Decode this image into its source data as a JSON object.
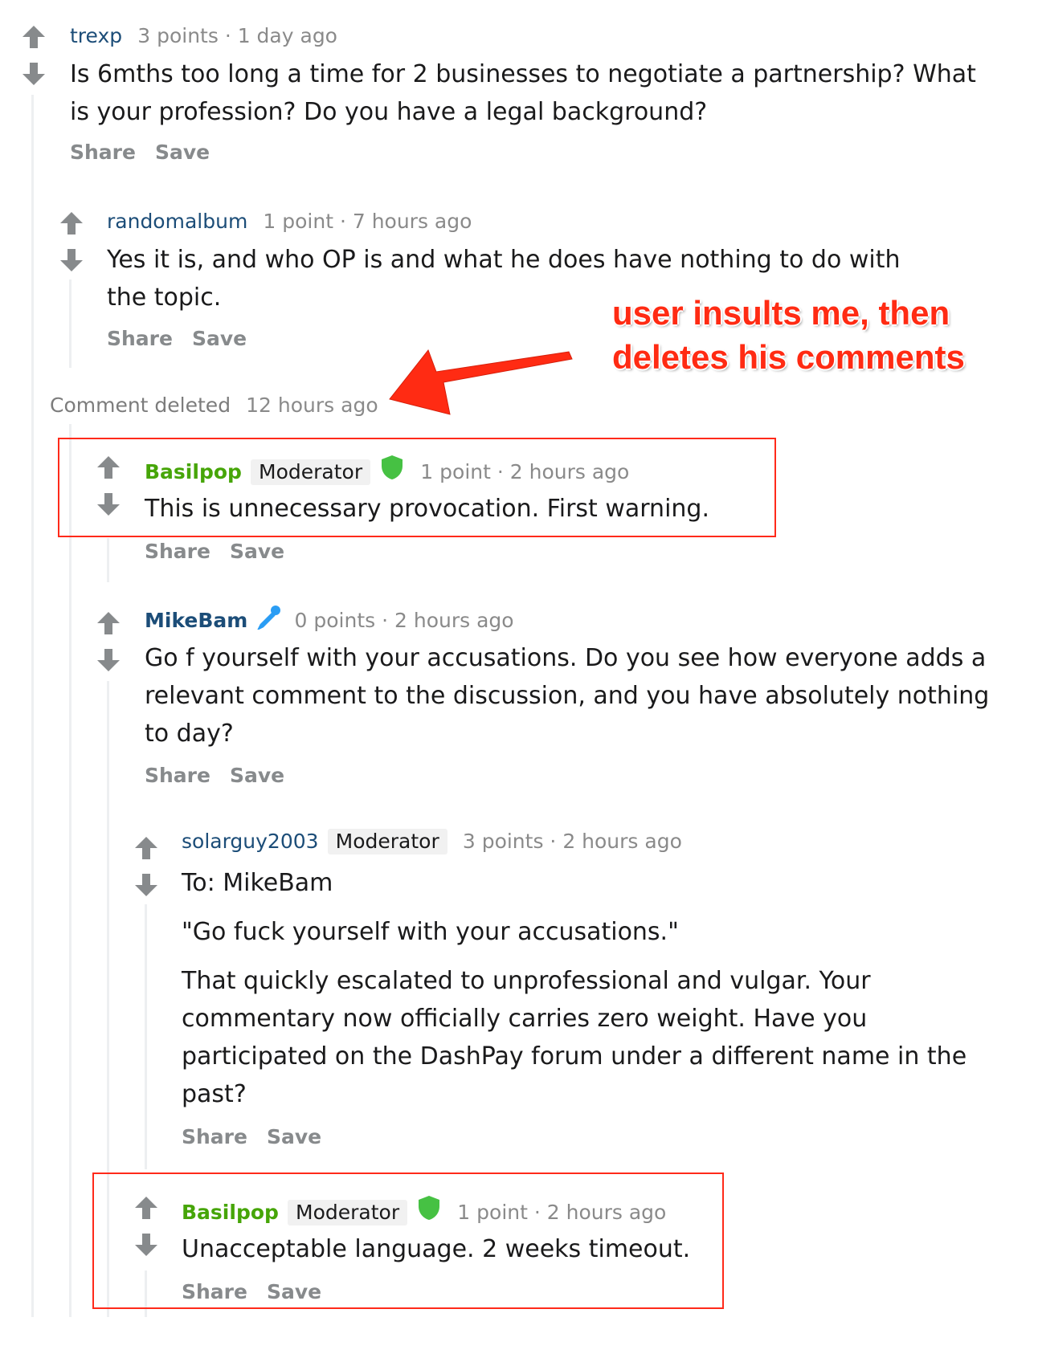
{
  "comments": [
    {
      "username": "trexp",
      "meta": "3 points · 1 day ago",
      "body": [
        "Is 6mths too long a time for 2 businesses to negotiate a partnership? What is your profession? Do you have a legal background?"
      ],
      "share_label": "Share",
      "save_label": "Save"
    },
    {
      "username": "randomalbum",
      "meta": "1 point · 7 hours ago",
      "body": [
        "Yes it is, and who OP is and what he does have nothing to do with the topic."
      ],
      "share_label": "Share",
      "save_label": "Save"
    },
    {
      "deleted_label": "Comment deleted",
      "meta": "12 hours ago"
    },
    {
      "username": "Basilpop",
      "badge": "Moderator",
      "meta": "1 point · 2 hours ago",
      "body": [
        "This is unnecessary provocation. First warning."
      ],
      "share_label": "Share",
      "save_label": "Save"
    },
    {
      "username": "MikeBam",
      "meta": "0 points · 2 hours ago",
      "body": [
        "Go f yourself with your accusations. Do you see how everyone adds a relevant comment to the discussion, and you have absolutely nothing to day?"
      ],
      "share_label": "Share",
      "save_label": "Save"
    },
    {
      "username": "solarguy2003",
      "badge": "Moderator",
      "meta": "3 points · 2 hours ago",
      "body": [
        "To: MikeBam",
        "\"Go fuck yourself with your accusations.\"",
        "That quickly escalated to unprofessional and vulgar. Your commentary now officially carries zero weight. Have you participated on the DashPay forum under a different name in the past?"
      ],
      "share_label": "Share",
      "save_label": "Save"
    },
    {
      "username": "Basilpop",
      "badge": "Moderator",
      "meta": "1 point · 2 hours ago",
      "body": [
        "Unacceptable language. 2 weeks timeout."
      ],
      "share_label": "Share",
      "save_label": "Save"
    }
  ],
  "annotation": {
    "line1": "user insults me, then",
    "line2": "deletes his comments"
  },
  "colors": {
    "moderator_name": "#46a508",
    "username": "#1c4d78",
    "annotation": "#ff2b13",
    "highlight_box": "#ff2a1a",
    "shield": "#46c143",
    "pencil": "#2a9df4"
  },
  "icons": [
    "upvote-arrow-icon",
    "downvote-arrow-icon",
    "moderator-shield-icon",
    "pencil-icon",
    "annotation-arrow-icon"
  ]
}
